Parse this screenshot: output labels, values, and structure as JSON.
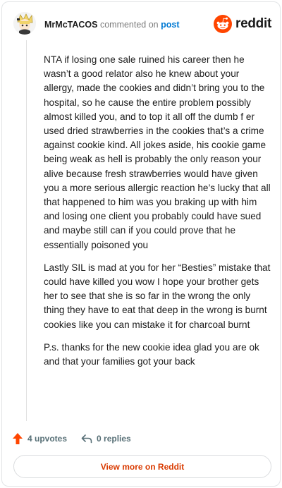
{
  "header": {
    "username": "MrMcTACOS",
    "commented_on": "commented on",
    "post_link": "post",
    "brand_name": "reddit",
    "brand_color": "#ff4500"
  },
  "comment": {
    "paragraphs": [
      "NTA if losing one sale ruined his career then he wasn’t a good relator also he knew about your allergy, made the cookies and didn’t bring you to the hospital, so he cause the entire problem possibly almost killed you, and to top it all off the dumb f er used dried strawberries in the cookies that’s a crime against cookie kind. All jokes aside, his cookie game being weak as hell is probably the only reason your alive because fresh strawberries would have given you a more serious allergic reaction he’s lucky that all that happened to him was you braking up with him and losing one client you probably could have sued and maybe still can if you could prove that he essentially poisoned you",
      "Lastly SIL is mad at you for her “Besties” mistake that could have killed you wow I hope your brother gets her to see that she is so far in the wrong the only thing they have to eat that deep in the wrong is burnt cookies like you can mistake it for charcoal burnt",
      "P.s. thanks for the new cookie idea glad you are ok and that your families got your back"
    ]
  },
  "actions": {
    "upvotes": "4 upvotes",
    "replies": "0 replies",
    "upvote_icon": "upvote-arrow-icon",
    "reply_icon": "reply-arrow-icon"
  },
  "footer": {
    "view_more": "View more on Reddit"
  }
}
